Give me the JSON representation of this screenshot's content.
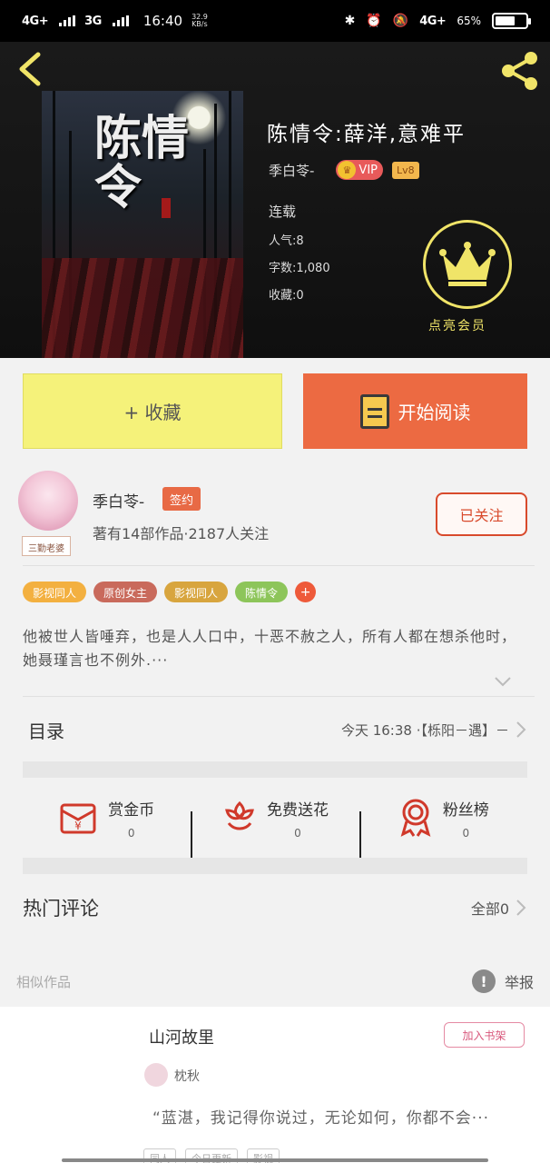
{
  "status_bar": {
    "network1": "4G+",
    "network2": "3G",
    "time": "16:40",
    "speed": "32.9 KB/s",
    "network_right": "4G+",
    "battery": "65%",
    "battery_fraction": 0.65
  },
  "book": {
    "title": "陈情令:薛洋,意难平",
    "author": "季白苓-",
    "vip": "VIP",
    "level": "Lv8",
    "status": "连载",
    "popularity": "人气:8",
    "word_count": "字数:1,080",
    "favorites": "收藏:0",
    "member_label": "点亮会员",
    "cover_title": "陈情令"
  },
  "actions": {
    "collect": "+ 收藏",
    "read": "开始阅读"
  },
  "author": {
    "name": "季白苓-",
    "badge": "签约",
    "avatar_tag": "三勤老婆",
    "stats": "著有14部作品·2187人关注",
    "follow": "已关注"
  },
  "tags": [
    {
      "label": "影视同人",
      "color": "#f3b040"
    },
    {
      "label": "原创女主",
      "color": "#c96a5c"
    },
    {
      "label": "影视同人",
      "color": "#d8a53e"
    },
    {
      "label": "陈情令",
      "color": "#8dc55a"
    }
  ],
  "tag_more": "+",
  "synopsis": "他被世人皆唾弃，也是人人口中，十恶不赦之人，所有人都在想杀他时，她聂瑾言也不例外.···",
  "catalog": {
    "label": "目录",
    "update": "今天 16:38 ·【栎阳－遇】－"
  },
  "stats": [
    {
      "name": "赏金币",
      "value": "0",
      "icon": "red-envelope-icon"
    },
    {
      "name": "免费送花",
      "value": "0",
      "icon": "flower-icon"
    },
    {
      "name": "粉丝榜",
      "value": "0",
      "icon": "medal-icon"
    }
  ],
  "hot_comments": {
    "label": "热门评论",
    "all": "全部0"
  },
  "similar": {
    "label": "相似作品",
    "report": "举报",
    "card": {
      "title": "山河故里",
      "add": "加入书架",
      "author": "枕秋",
      "quote": "“蓝湛，我记得你说过，无论如何，你都不会···",
      "tags": [
        "同人",
        "今日更新",
        "影视"
      ]
    }
  }
}
